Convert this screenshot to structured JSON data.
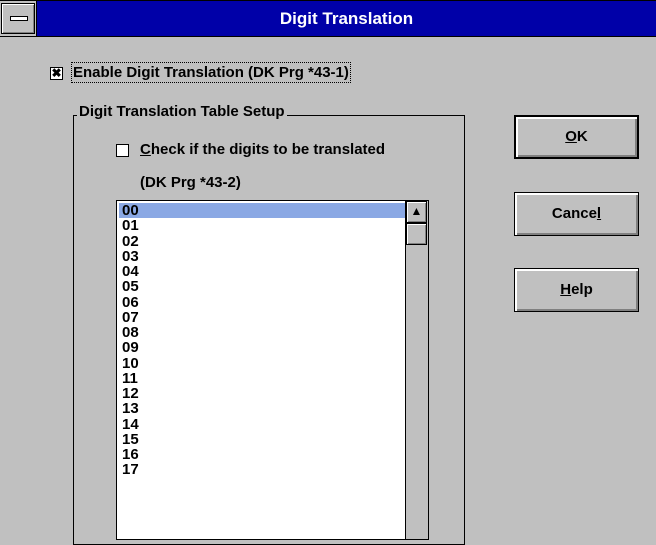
{
  "window": {
    "title": "Digit Translation"
  },
  "enable_checkbox": {
    "checked_mark": "✖",
    "label": "Enable Digit Translation (DK Prg *43-1)"
  },
  "group": {
    "label": "Digit Translation Table Setup"
  },
  "check_digits": {
    "label": "Check if the digits to be translated",
    "sublabel": "(DK Prg *43-2)"
  },
  "list": {
    "items": [
      "00",
      "01",
      "02",
      "03",
      "04",
      "05",
      "06",
      "07",
      "08",
      "09",
      "10",
      "11",
      "12",
      "13",
      "14",
      "15",
      "16",
      "17"
    ],
    "selected_index": 0
  },
  "buttons": {
    "ok": {
      "pre": "",
      "accel": "O",
      "post": "K"
    },
    "cancel": {
      "pre": "Cance",
      "accel": "l",
      "post": ""
    },
    "help": {
      "pre": "",
      "accel": "H",
      "post": "elp"
    }
  },
  "colors": {
    "titlebar": "#0000a8",
    "selection": "#8aa8e4",
    "face": "#c0c0c0"
  }
}
